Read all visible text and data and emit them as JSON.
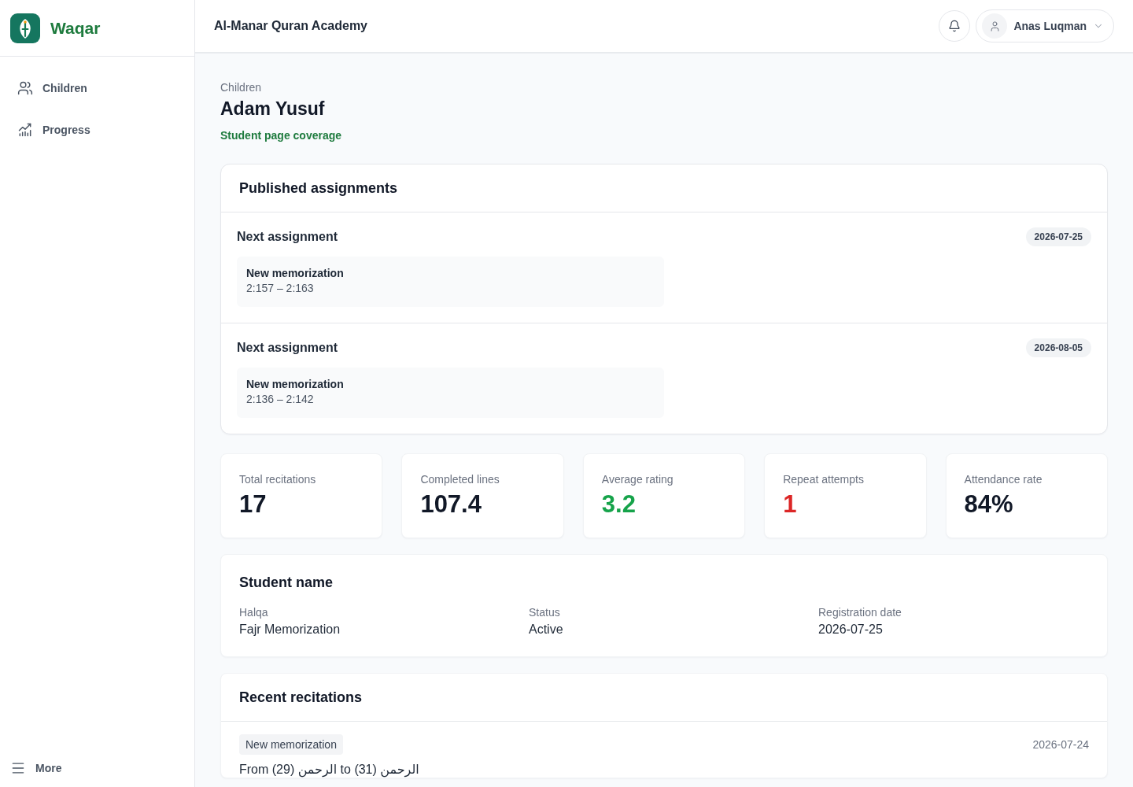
{
  "sidebar": {
    "brand": "Waqar",
    "items": [
      {
        "label": "Children",
        "selected": false
      },
      {
        "label": "Progress",
        "selected": false
      }
    ],
    "more": "More"
  },
  "header": {
    "title": "Al-Manar Quran Academy",
    "user": "Anas Luqman"
  },
  "page": {
    "breadcrumb": "Children",
    "title": "Adam Yusuf",
    "link": "Student page coverage"
  },
  "assignments": {
    "title": "Published assignments",
    "items": [
      {
        "title": "Next assignment",
        "date": "2026-07-25",
        "type": "New memorization",
        "range": "2:157 – 2:163"
      },
      {
        "title": "Next assignment",
        "date": "2026-08-05",
        "type": "New memorization",
        "range": "2:136 – 2:142"
      }
    ]
  },
  "stats": [
    {
      "label": "Total recitations",
      "value": "17",
      "color": "#111827"
    },
    {
      "label": "Completed lines",
      "value": "107.4",
      "color": "#111827"
    },
    {
      "label": "Average rating",
      "value": "3.2",
      "color": "#16a34a"
    },
    {
      "label": "Repeat attempts",
      "value": "1",
      "color": "#dc2626"
    },
    {
      "label": "Attendance rate",
      "value": "84%",
      "color": "#111827"
    }
  ],
  "student": {
    "title": "Student name",
    "fields": [
      {
        "label": "Halqa",
        "value": "Fajr Memorization"
      },
      {
        "label": "Status",
        "value": "Active"
      },
      {
        "label": "Registration date",
        "value": "2026-07-25"
      }
    ]
  },
  "recitations": {
    "title": "Recent recitations",
    "items": [
      {
        "type": "New memorization",
        "date": "2026-07-24",
        "text": "From (29) الرحمن to (31) الرحمن"
      }
    ]
  }
}
